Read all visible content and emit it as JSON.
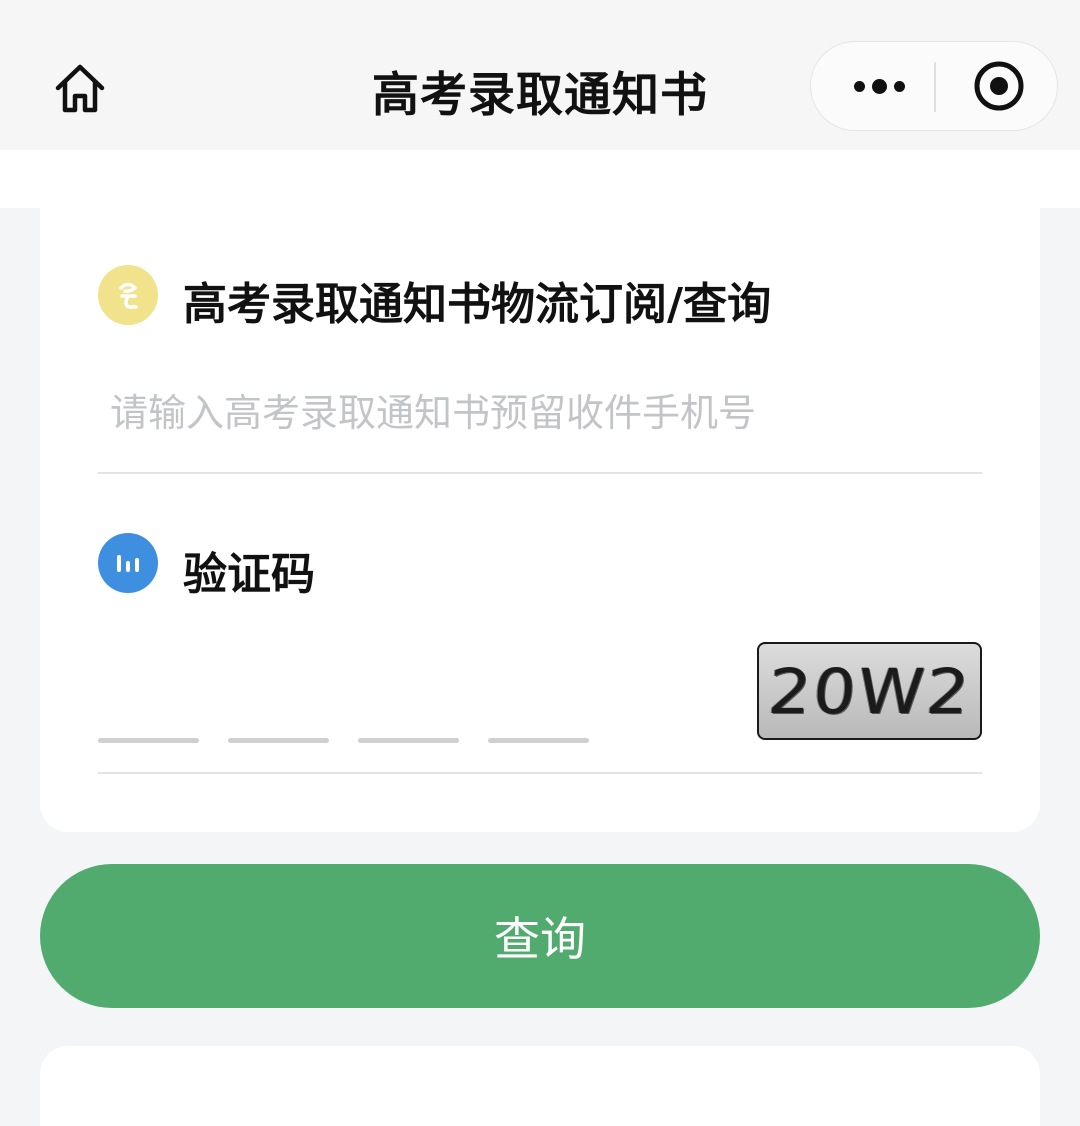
{
  "header": {
    "title": "高考录取通知书",
    "home_icon": "home-icon",
    "more_icon": "more-dots-icon",
    "close_icon": "target-circle-icon"
  },
  "form": {
    "phone_section": {
      "title": "高考录取通知书物流订阅/查询",
      "icon": "tracking-icon",
      "icon_color": "#f0e38c",
      "placeholder": "请输入高考录取通知书预留收件手机号",
      "value": ""
    },
    "captcha_section": {
      "title": "验证码",
      "icon": "bar-chart-icon",
      "icon_color": "#3f8fe0",
      "code_slots": 4,
      "captcha_text": "20W2"
    }
  },
  "actions": {
    "query_label": "查询",
    "query_color": "#52ab6e"
  }
}
